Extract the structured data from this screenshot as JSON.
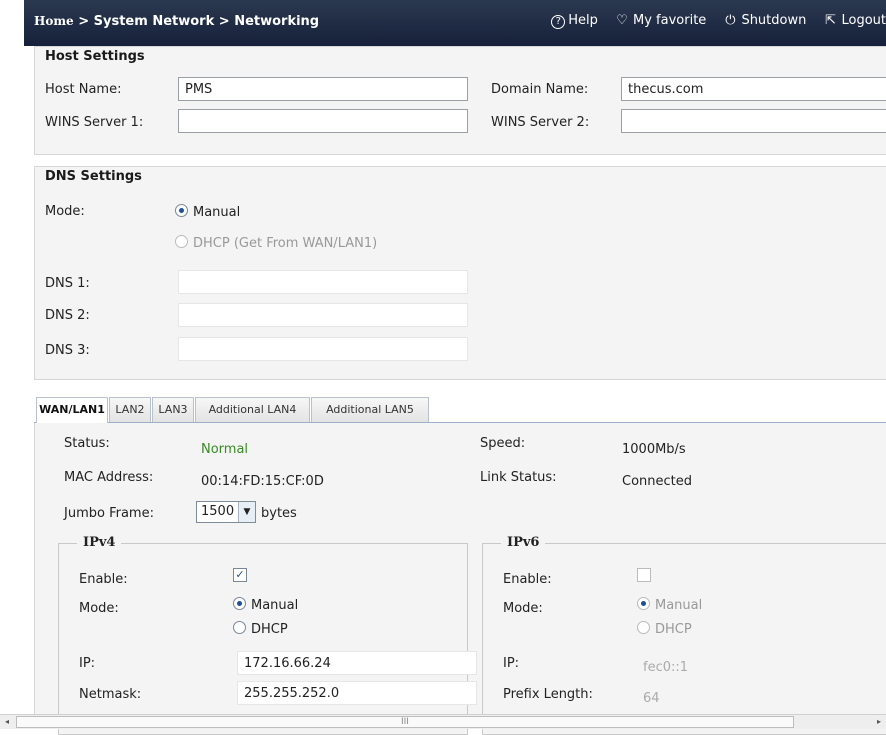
{
  "header": {
    "breadcrumb_home": "Home",
    "breadcrumb_sep1": " > ",
    "breadcrumb_mid": "System Network",
    "breadcrumb_sep2": " > ",
    "breadcrumb_current": "Networking",
    "help": "Help",
    "favorite": "My favorite",
    "shutdown": "Shutdown",
    "logout": "Logout"
  },
  "host": {
    "legend": "Host Settings",
    "host_name_label": "Host Name:",
    "host_name_value": "PMS",
    "domain_label": "Domain Name:",
    "domain_value": "thecus.com",
    "wins1_label": "WINS Server 1:",
    "wins1_value": "",
    "wins2_label": "WINS Server 2:",
    "wins2_value": ""
  },
  "dns": {
    "legend": "DNS Settings",
    "mode_label": "Mode:",
    "manual": "Manual",
    "dhcp": "DHCP (Get From WAN/LAN1)",
    "dns1_label": "DNS 1:",
    "dns2_label": "DNS 2:",
    "dns3_label": "DNS 3:"
  },
  "tabs": [
    "WAN/LAN1",
    "LAN2",
    "LAN3",
    "Additional LAN4",
    "Additional LAN5"
  ],
  "lan": {
    "status_label": "Status:",
    "status_value": "Normal",
    "speed_label": "Speed:",
    "speed_value": "1000Mb/s",
    "mac_label": "MAC Address:",
    "mac_value": "00:14:FD:15:CF:0D",
    "link_label": "Link Status:",
    "link_value": "Connected",
    "jumbo_label": "Jumbo Frame:",
    "jumbo_value": "1500",
    "jumbo_unit": "bytes"
  },
  "ipv4": {
    "legend": "IPv4",
    "enable_label": "Enable:",
    "mode_label": "Mode:",
    "manual": "Manual",
    "dhcp": "DHCP",
    "ip_label": "IP:",
    "ip_value": "172.16.66.24",
    "netmask_label": "Netmask:",
    "netmask_value": "255.255.252.0"
  },
  "ipv6": {
    "legend": "IPv6",
    "enable_label": "Enable:",
    "mode_label": "Mode:",
    "manual": "Manual",
    "dhcp": "DHCP",
    "ip_label": "IP:",
    "ip_value": "fec0::1",
    "prefix_label": "Prefix Length:",
    "prefix_value": "64"
  },
  "scrollbar": {
    "left_arrow": "◂",
    "right_arrow": "▸",
    "grip": "III"
  },
  "icons": {
    "help": "?",
    "favorite": "♡",
    "shutdown": "⏻",
    "logout": "⇱",
    "checkmark": "✓",
    "dropdown": "▼"
  }
}
